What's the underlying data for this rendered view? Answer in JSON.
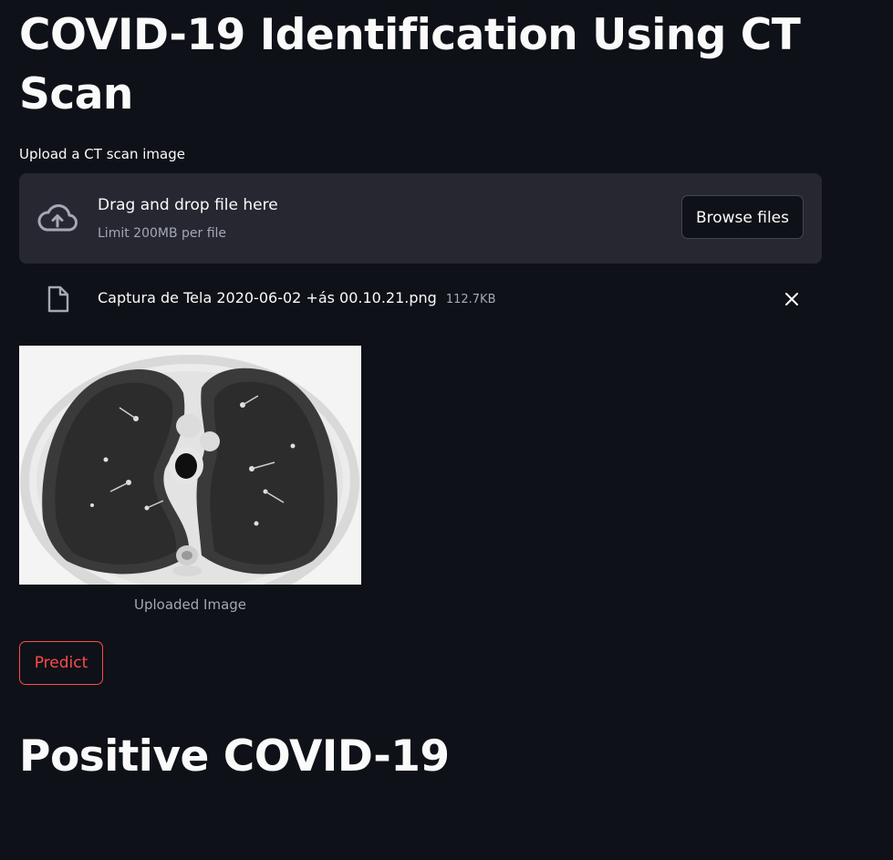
{
  "page": {
    "title": "COVID-19 Identification Using CT Scan"
  },
  "uploader": {
    "label": "Upload a CT scan image",
    "dropzone_title": "Drag and drop file here",
    "dropzone_limit": "Limit 200MB per file",
    "browse_label": "Browse files",
    "icon": "cloud-upload-icon"
  },
  "uploaded_file": {
    "name": "Captura de Tela 2020-06-02 +ás 00.10.21.png",
    "size": "112.7KB",
    "icon": "file-icon",
    "remove_icon": "close-icon"
  },
  "image": {
    "caption": "Uploaded Image"
  },
  "actions": {
    "predict_label": "Predict"
  },
  "result": {
    "text": "Positive COVID-19"
  },
  "colors": {
    "background": "#0e1117",
    "surface": "#262730",
    "text": "#fafafa",
    "muted": "#a3a8b4",
    "accent": "#ff4b4b"
  }
}
